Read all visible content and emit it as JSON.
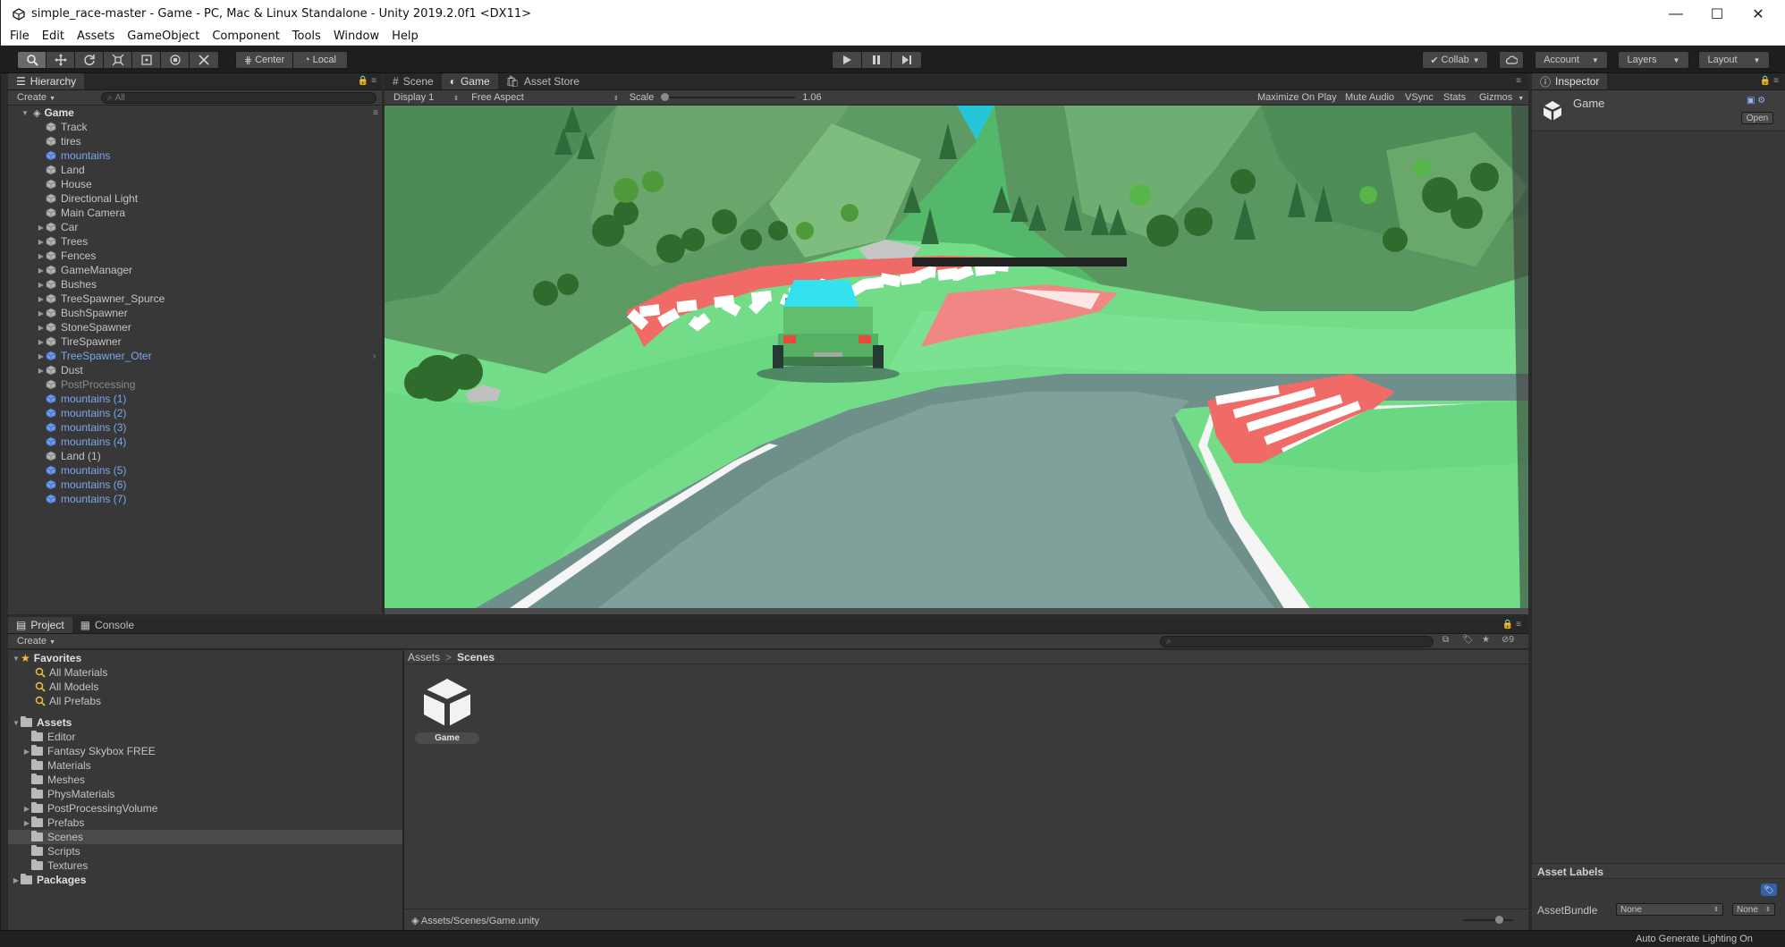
{
  "window": {
    "title": "simple_race-master - Game - PC, Mac & Linux Standalone - Unity 2019.2.0f1 <DX11>",
    "minimize": "—",
    "maximize": "☐",
    "close": "✕"
  },
  "menu": [
    "File",
    "Edit",
    "Assets",
    "GameObject",
    "Component",
    "Tools",
    "Window",
    "Help"
  ],
  "toolbar": {
    "pivot_center": "Center",
    "pivot_local": "Local",
    "collab": "Collab",
    "account": "Account",
    "layers": "Layers",
    "layout": "Layout"
  },
  "hierarchy": {
    "tab": "Hierarchy",
    "create": "Create",
    "search_placeholder": "All",
    "scene_name": "Game",
    "items": [
      {
        "label": "Track",
        "expandable": false,
        "prefab": false
      },
      {
        "label": "tires",
        "expandable": false,
        "prefab": false
      },
      {
        "label": "mountains",
        "expandable": false,
        "prefab": true
      },
      {
        "label": "Land",
        "expandable": false,
        "prefab": false
      },
      {
        "label": "House",
        "expandable": false,
        "prefab": false
      },
      {
        "label": "Directional Light",
        "expandable": false,
        "prefab": false
      },
      {
        "label": "Main Camera",
        "expandable": false,
        "prefab": false
      },
      {
        "label": "Car",
        "expandable": true,
        "prefab": false
      },
      {
        "label": "Trees",
        "expandable": true,
        "prefab": false
      },
      {
        "label": "Fences",
        "expandable": true,
        "prefab": false
      },
      {
        "label": "GameManager",
        "expandable": true,
        "prefab": false
      },
      {
        "label": "Bushes",
        "expandable": true,
        "prefab": false
      },
      {
        "label": "TreeSpawner_Spurce",
        "expandable": true,
        "prefab": false
      },
      {
        "label": "BushSpawner",
        "expandable": true,
        "prefab": false
      },
      {
        "label": "StoneSpawner",
        "expandable": true,
        "prefab": false
      },
      {
        "label": "TireSpawner",
        "expandable": true,
        "prefab": false
      },
      {
        "label": "TreeSpawner_Oter",
        "expandable": true,
        "prefab": true
      },
      {
        "label": "Dust",
        "expandable": true,
        "prefab": false
      },
      {
        "label": "PostProcessing",
        "expandable": false,
        "prefab": false,
        "disabled": true
      },
      {
        "label": "mountains (1)",
        "expandable": false,
        "prefab": true
      },
      {
        "label": "mountains (2)",
        "expandable": false,
        "prefab": true
      },
      {
        "label": "mountains (3)",
        "expandable": false,
        "prefab": true
      },
      {
        "label": "mountains (4)",
        "expandable": false,
        "prefab": true
      },
      {
        "label": "Land (1)",
        "expandable": false,
        "prefab": false
      },
      {
        "label": "mountains (5)",
        "expandable": false,
        "prefab": true
      },
      {
        "label": "mountains (6)",
        "expandable": false,
        "prefab": true
      },
      {
        "label": "mountains (7)",
        "expandable": false,
        "prefab": true
      }
    ]
  },
  "center_tabs": [
    {
      "label": "Scene",
      "active": false
    },
    {
      "label": "Game",
      "active": true
    },
    {
      "label": "Asset Store",
      "active": false
    }
  ],
  "game_view": {
    "display": "Display 1",
    "aspect": "Free Aspect",
    "scale_label": "Scale",
    "scale_value": "1.06",
    "maximize_on_play": "Maximize On Play",
    "mute_audio": "Mute Audio",
    "vsync": "VSync",
    "stats": "Stats",
    "gizmos": "Gizmos"
  },
  "inspector": {
    "tab": "Inspector",
    "asset_name": "Game",
    "open_button": "Open",
    "asset_labels": "Asset Labels",
    "asset_bundle_label": "AssetBundle",
    "asset_bundle_value": "None",
    "asset_bundle_variant": "None"
  },
  "project": {
    "tabs": [
      {
        "label": "Project",
        "active": true
      },
      {
        "label": "Console",
        "active": false
      }
    ],
    "create": "Create",
    "hidden_count": "9",
    "favorites_label": "Favorites",
    "favorites": [
      "All Materials",
      "All Models",
      "All Prefabs"
    ],
    "assets_label": "Assets",
    "folders": [
      {
        "label": "Editor",
        "expandable": false
      },
      {
        "label": "Fantasy Skybox FREE",
        "expandable": true
      },
      {
        "label": "Materials",
        "expandable": false
      },
      {
        "label": "Meshes",
        "expandable": false
      },
      {
        "label": "PhysMaterials",
        "expandable": false
      },
      {
        "label": "PostProcessingVolume",
        "expandable": true
      },
      {
        "label": "Prefabs",
        "expandable": true
      },
      {
        "label": "Scenes",
        "expandable": false,
        "selected": true
      },
      {
        "label": "Scripts",
        "expandable": false
      },
      {
        "label": "Textures",
        "expandable": false
      }
    ],
    "packages_label": "Packages",
    "breadcrumb": [
      "Assets",
      "Scenes"
    ],
    "breadcrumb_sep": ">",
    "asset_tile": "Game",
    "path": "Assets/Scenes/Game.unity"
  },
  "status": {
    "text": "Auto Generate Lighting On"
  },
  "colors": {
    "prefab_blue": "#7ba7ee",
    "sky_cyan": "#26c6da",
    "grass": "#6fd987",
    "car_green": "#5fbf6e",
    "car_cabin": "#33e2ee"
  }
}
